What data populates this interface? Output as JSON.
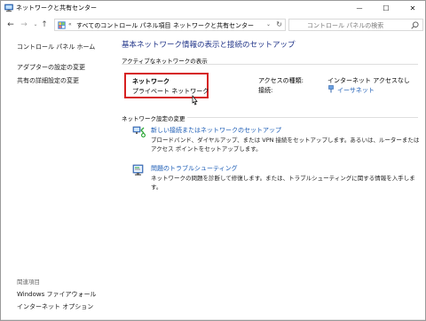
{
  "window": {
    "title": "ネットワークと共有センター",
    "minimize_glyph": "—",
    "maximize_glyph": "☐",
    "close_glyph": "✕"
  },
  "nav": {
    "back_glyph": "←",
    "forward_glyph": "→",
    "recent_glyph": "⌄",
    "up_glyph": "↑"
  },
  "address": {
    "overflow_glyph": "«",
    "crumbs": [
      "すべてのコントロール パネル項目",
      "ネットワークと共有センター"
    ],
    "separator": "›",
    "dropdown_glyph": "⌄",
    "refresh_glyph": "↻"
  },
  "search": {
    "placeholder": "コントロール パネルの検索"
  },
  "sidebar": {
    "home": "コントロール パネル ホーム",
    "items": [
      "アダプターの設定の変更",
      "共有の詳細設定の変更"
    ],
    "related_label": "関連項目",
    "related": [
      "Windows ファイアウォール",
      "インターネット オプション"
    ]
  },
  "main": {
    "heading": "基本ネットワーク情報の表示と接続のセットアップ",
    "active_networks_label": "アクティブなネットワークの表示",
    "network": {
      "name": "ネットワーク",
      "type": "プライベート ネットワーク",
      "access_label": "アクセスの種類:",
      "access_value": "インターネット アクセスなし",
      "connection_label": "接続:",
      "connection_value": "イーサネット"
    },
    "settings_label": "ネットワーク設定の変更",
    "tasks": [
      {
        "title": "新しい接続またはネットワークのセットアップ",
        "desc": "ブロードバンド、ダイヤルアップ、または VPN 接続をセットアップします。あるいは、ルーターまたはアクセス ポイントをセットアップします。",
        "icon": "new-connection-icon"
      },
      {
        "title": "問題のトラブルシューティング",
        "desc": "ネットワークの問題を診断して修復します。または、トラブルシューティングに関する情報を入手します。",
        "icon": "troubleshoot-icon"
      }
    ]
  },
  "colors": {
    "heading": "#1e3287",
    "link": "#1a5bb5",
    "highlight": "#d61f1f"
  }
}
